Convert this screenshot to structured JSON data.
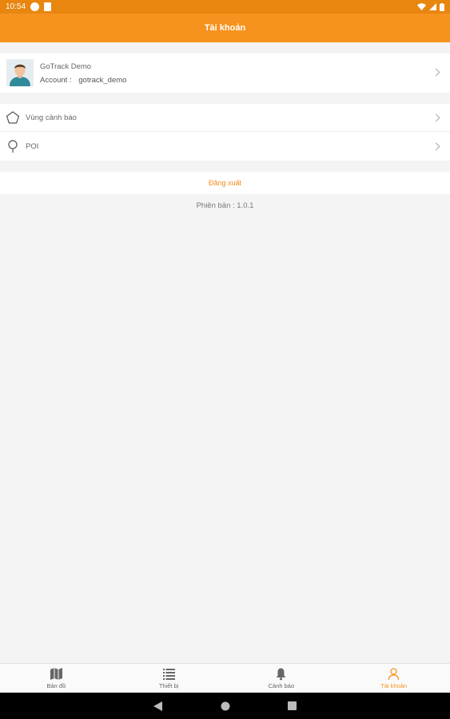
{
  "status_bar": {
    "time": "10:54",
    "icons": [
      "app-icon",
      "sd-card-icon",
      "wifi-icon",
      "signal-icon",
      "battery-icon"
    ]
  },
  "app_bar": {
    "title": "Tài khoản"
  },
  "profile": {
    "name": "GoTrack Demo",
    "account_label": "Account :",
    "account_value": "gotrack_demo",
    "avatar_icon": "user-avatar"
  },
  "menu": [
    {
      "label": "Vùng cảnh báo",
      "icon": "pentagon-icon"
    },
    {
      "label": "POI",
      "icon": "location-pin-icon"
    }
  ],
  "logout": {
    "label": "Đăng xuất"
  },
  "version": {
    "text": "Phiên bản : 1.0.1"
  },
  "bottom_nav": [
    {
      "label": "Bản đồ",
      "icon": "map-icon",
      "active": false
    },
    {
      "label": "Thiết bị",
      "icon": "list-icon",
      "active": false
    },
    {
      "label": "Cảnh báo",
      "icon": "bell-icon",
      "active": false
    },
    {
      "label": "Tài khoản",
      "icon": "person-icon",
      "active": true
    }
  ],
  "colors": {
    "status_bar": "#e8860f",
    "app_bar": "#f6931e",
    "accent": "#f08b16",
    "background": "#f4f4f4"
  }
}
